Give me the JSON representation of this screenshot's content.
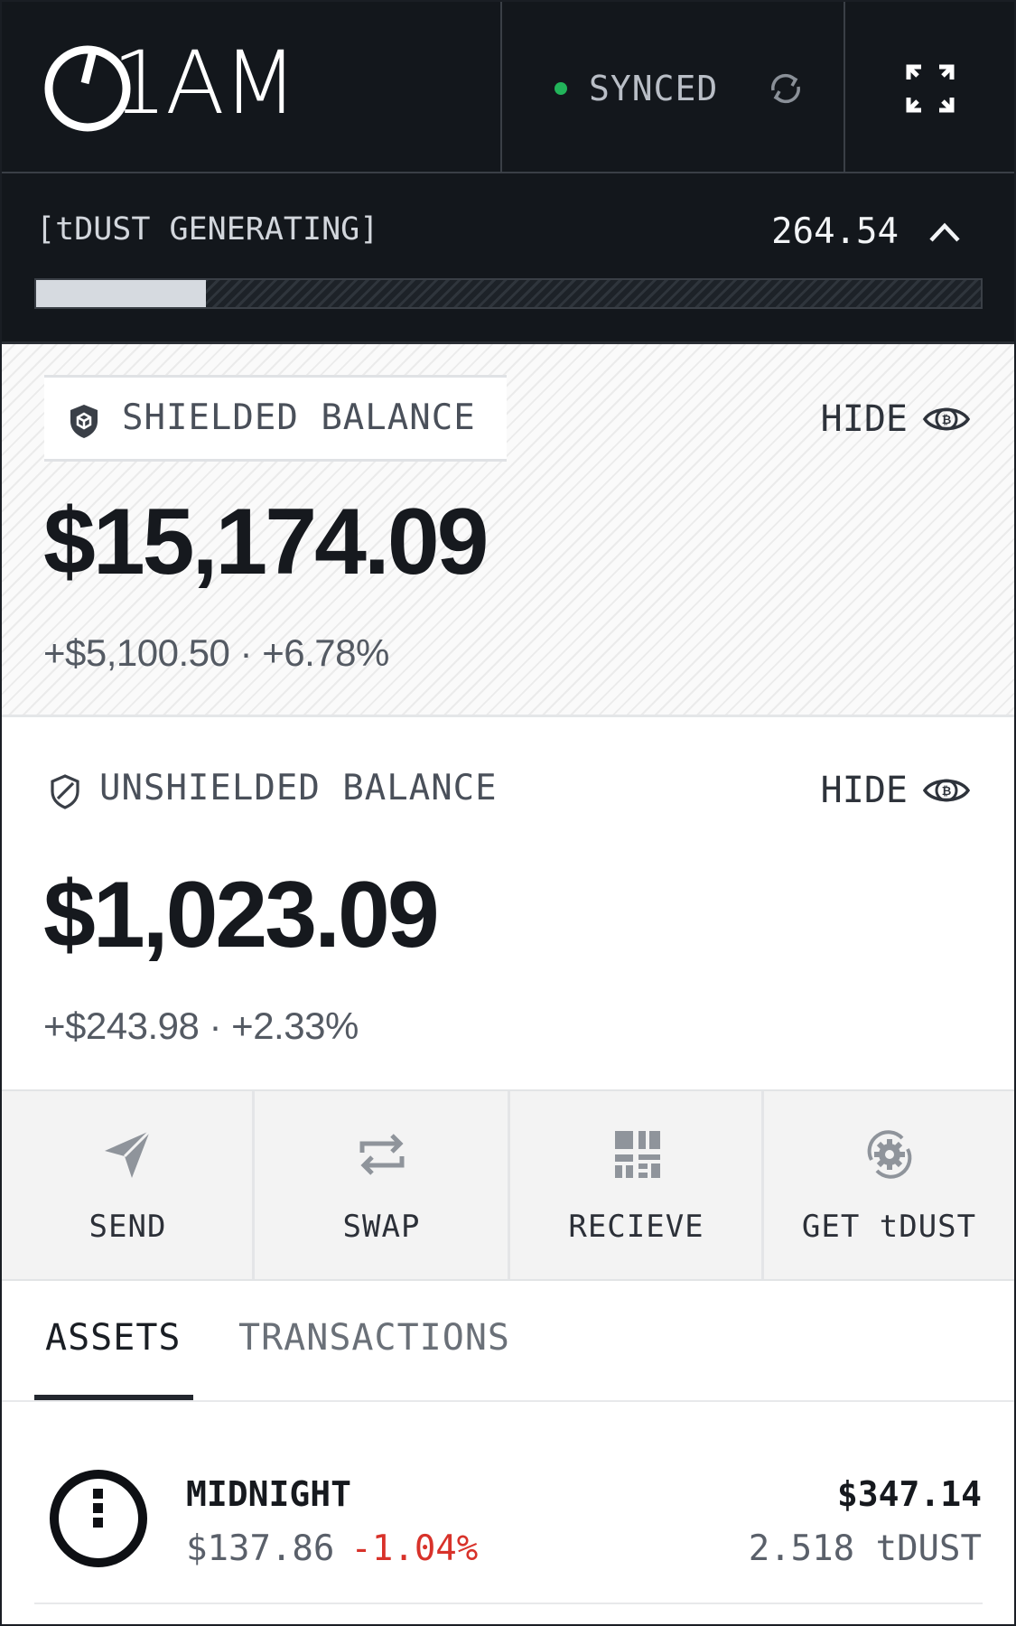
{
  "app": {
    "logo_text": "1AM"
  },
  "header": {
    "sync_status": "SYNCED",
    "sync_color": "#22b45a",
    "icons": [
      "power-icon",
      "refresh-icon",
      "expand-icon"
    ]
  },
  "dust": {
    "label": "[tDUST GENERATING]",
    "value": "264.54",
    "progress_fraction": 0.18
  },
  "shielded": {
    "label": "SHIELDED BALANCE",
    "hide_label": "HIDE",
    "balance": "$15,174.09",
    "change": "+$5,100.50 · +6.78%"
  },
  "unshielded": {
    "label": "UNSHIELDED BALANCE",
    "hide_label": "HIDE",
    "balance": "$1,023.09",
    "change": "+$243.98 · +2.33%"
  },
  "actions": [
    {
      "label": "SEND",
      "icon": "send-icon"
    },
    {
      "label": "SWAP",
      "icon": "swap-icon"
    },
    {
      "label": "RECIEVE",
      "icon": "qr-code-icon"
    },
    {
      "label": "GET tDUST",
      "icon": "gear-refresh-icon"
    }
  ],
  "tabs": [
    {
      "label": "ASSETS",
      "active": true
    },
    {
      "label": "TRANSACTIONS",
      "active": false
    }
  ],
  "assets": [
    {
      "name": "MIDNIGHT",
      "price": "$137.86",
      "change": "-1.04%",
      "value": "$347.14",
      "quantity": "2.518 tDUST",
      "change_color": "#d8322a"
    }
  ]
}
